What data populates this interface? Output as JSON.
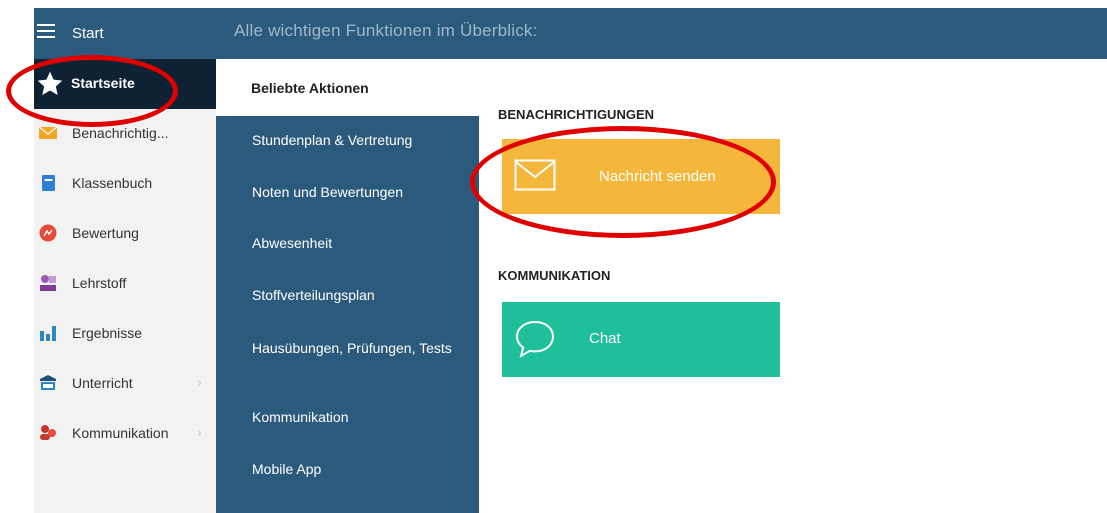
{
  "sidebar": {
    "title": "Start",
    "items": [
      {
        "label": "Startseite",
        "icon": "star-icon"
      },
      {
        "label": "Benachrichtig...",
        "icon": "envelope-icon"
      },
      {
        "label": "Klassenbuch",
        "icon": "book-icon"
      },
      {
        "label": "Bewertung",
        "icon": "rating-icon"
      },
      {
        "label": "Lehrstoff",
        "icon": "teacher-icon"
      },
      {
        "label": "Ergebnisse",
        "icon": "bar-chart-icon"
      },
      {
        "label": "Unterricht",
        "icon": "classroom-icon"
      },
      {
        "label": "Kommunikation",
        "icon": "chat-people-icon"
      }
    ]
  },
  "header": {
    "heading": "Alle wichtigen Funktionen im Überblick:"
  },
  "menu": {
    "items": [
      {
        "label": "Beliebte Aktionen"
      },
      {
        "label": "Stundenplan & Vertretung"
      },
      {
        "label": "Noten und Bewertungen"
      },
      {
        "label": "Abwesenheit"
      },
      {
        "label": "Stoffverteilungsplan"
      },
      {
        "label": "Hausübungen, Prüfungen, Tests"
      },
      {
        "label": "Kommunikation"
      },
      {
        "label": "Mobile App"
      }
    ]
  },
  "content": {
    "sections": [
      {
        "title": "BENACHRICHTIGUNGEN",
        "tile_label": "Nachricht senden",
        "icon": "envelope-icon",
        "color": "#f5b73b"
      },
      {
        "title": "KOMMUNIKATION",
        "tile_label": "Chat",
        "icon": "chat-bubble-icon",
        "color": "#1fbf9b"
      }
    ]
  },
  "colors": {
    "nav_blue": "#2b5a7d",
    "active_dark": "#0f2233",
    "highlight_red": "#e10000"
  }
}
